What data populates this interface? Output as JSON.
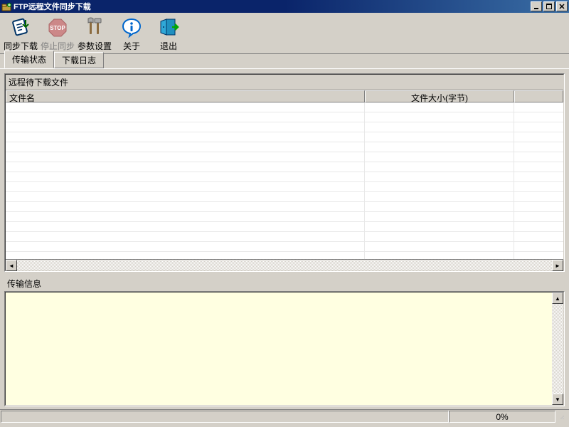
{
  "window": {
    "title": "FTP远程文件同步下载"
  },
  "toolbar": {
    "sync_download": "同步下载",
    "stop_sync": "停止同步",
    "settings": "参数设置",
    "about": "关于",
    "exit": "退出"
  },
  "tabs": {
    "transfer_status": "传输状态",
    "download_log": "下载日志"
  },
  "panel": {
    "remote_pending_title": "远程待下载文件",
    "col_filename": "文件名",
    "col_filesize": "文件大小(字节)"
  },
  "info": {
    "title": "传输信息"
  },
  "status": {
    "main": "",
    "percent": "0%"
  }
}
